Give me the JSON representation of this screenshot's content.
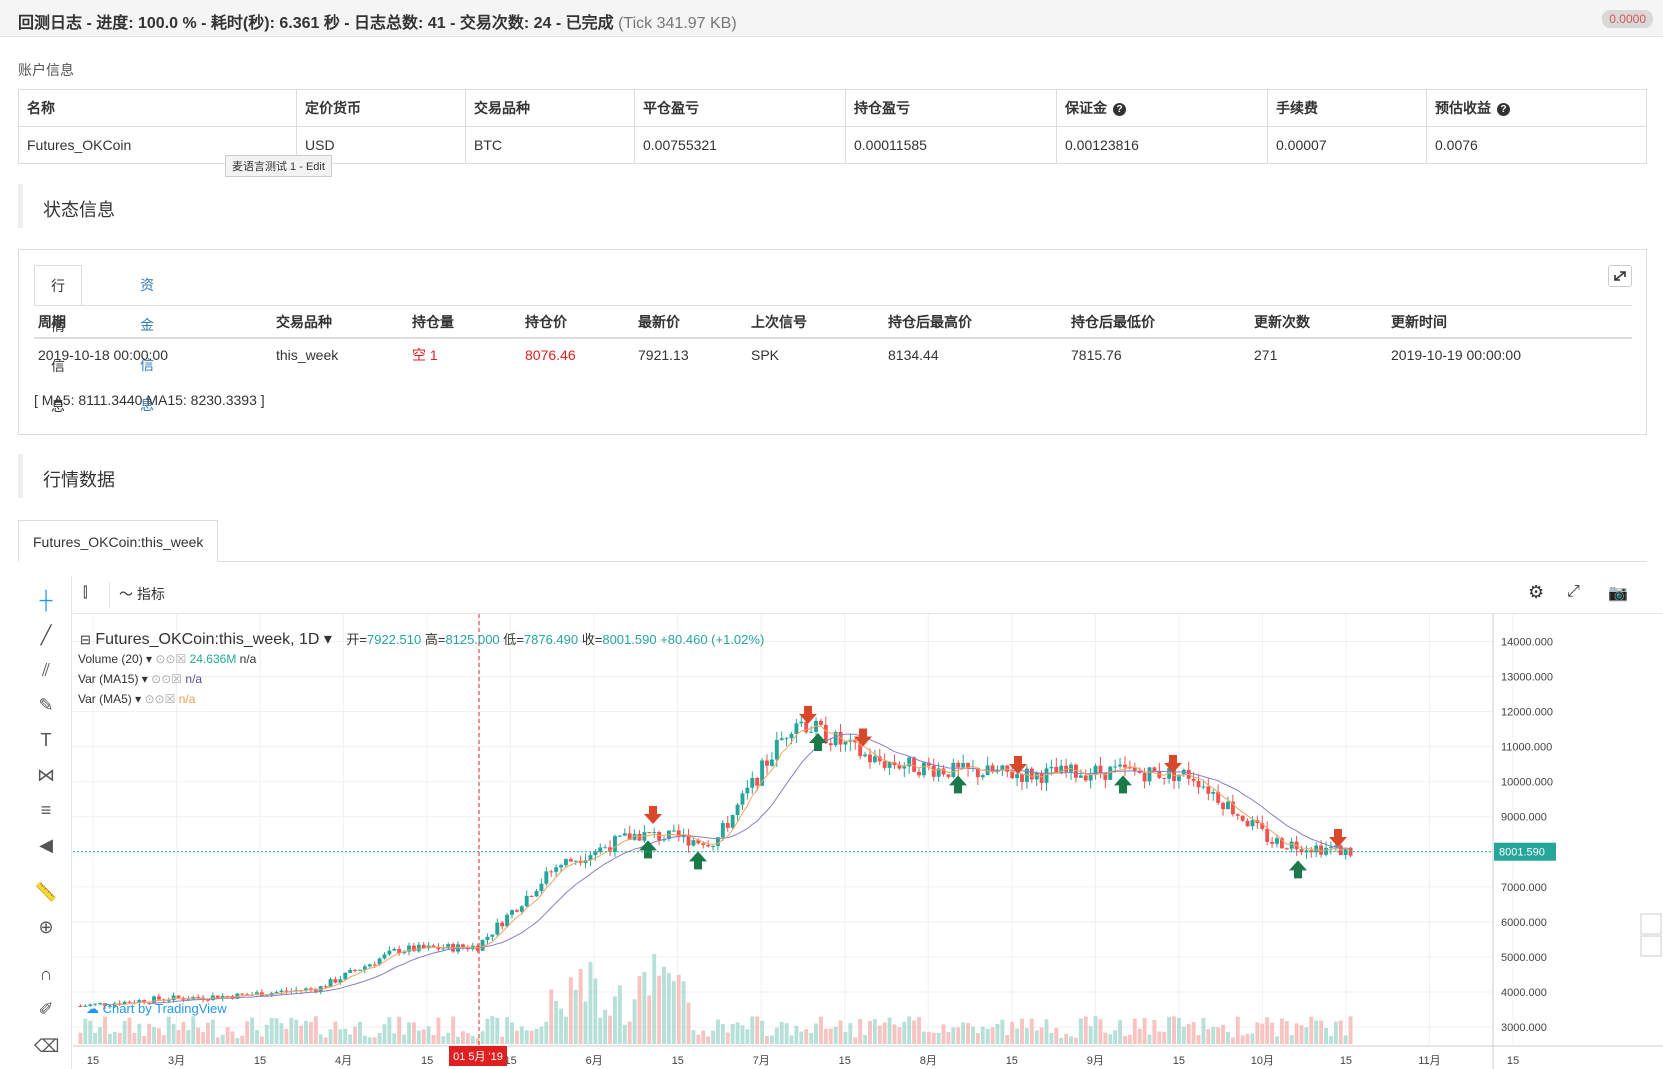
{
  "topbar": {
    "title_main": "回测日志 - 进度: 100.0 % - 耗时(秒): 6.361 秒 - 日志总数: 41 - 交易次数: 24 - 已完成",
    "title_tick": "(Tick 341.97 KB)",
    "badge": "0.0000"
  },
  "account": {
    "label": "账户信息",
    "headers": [
      "名称",
      "定价货币",
      "交易品种",
      "平仓盈亏",
      "持仓盈亏",
      "保证金",
      "手续费",
      "预估收益"
    ],
    "row": [
      "Futures_OKCoin",
      "USD",
      "BTC",
      "0.00755321",
      "0.00011585",
      "0.00123816",
      "0.00007",
      "0.0076"
    ],
    "help_icon": "?"
  },
  "tooltip": "麦语言测试 1 - Edit",
  "status": {
    "title": "状态信息",
    "tabs": [
      "行情信息",
      "资金信息"
    ],
    "headers": [
      "周期",
      "交易品种",
      "持仓量",
      "持仓价",
      "最新价",
      "上次信号",
      "持仓后最高价",
      "持仓后最低价",
      "更新次数",
      "更新时间"
    ],
    "row": [
      "2019-10-18 00:00:00",
      "this_week",
      "空 1",
      "8076.46",
      "7921.13",
      "SPK",
      "8134.44",
      "7815.76",
      "271",
      "2019-10-19 00:00:00"
    ],
    "ma_line": "[ MA5: 8111.3440 MA15: 8230.3393 ]"
  },
  "market": {
    "title": "行情数据",
    "chart_tab": "Futures_OKCoin:this_week"
  },
  "tv": {
    "indicator_label": "指标",
    "symbol": "Futures_OKCoin:this_week, 1D",
    "o_label": "开=",
    "o_val": "7922.510",
    "h_label": "高=",
    "h_val": "8125.000",
    "l_label": "低=",
    "l_val": "7876.490",
    "c_label": "收=",
    "c_val": "8001.590",
    "change": "+80.460 (+1.02%)",
    "vol_label": "Volume (20)",
    "vol_val": "24.636M",
    "vol_na": "n/a",
    "ma15_label": "Var (MA15)",
    "ma15_val": "n/a",
    "ma5_label": "Var (MA5)",
    "ma5_val": "n/a",
    "watermark": "Chart by TradingView",
    "price_tag": "8001.590",
    "crosshair_label": "01 5月 '19",
    "y_ticks": [
      "14000.000",
      "13000.000",
      "12000.000",
      "11000.000",
      "10000.000",
      "9000.000",
      "8000.000",
      "7000.000",
      "6000.000",
      "5000.000",
      "4000.000",
      "3000.000"
    ],
    "x_ticks": [
      "15",
      "3月",
      "15",
      "4月",
      "15",
      "15",
      "6月",
      "15",
      "7月",
      "15",
      "8月",
      "15",
      "9月",
      "15",
      "10月",
      "15",
      "11月",
      "15"
    ],
    "colors": {
      "up": "#26a69a",
      "down": "#ef5350",
      "ma15": "#8e7cc3",
      "ma5": "#f4a460",
      "accent": "#e02020"
    }
  },
  "chart_data": {
    "type": "candlestick",
    "title": "Futures_OKCoin:this_week, 1D",
    "xlabel": "",
    "ylabel": "",
    "ylim": [
      2800,
      14500
    ],
    "monthly_close_approx": [
      {
        "x": "2月15",
        "close": 3600
      },
      {
        "x": "3月",
        "close": 3800
      },
      {
        "x": "3月15",
        "close": 3900
      },
      {
        "x": "4月",
        "close": 4100
      },
      {
        "x": "4月15",
        "close": 5200
      },
      {
        "x": "5月1",
        "close": 5300
      },
      {
        "x": "5月15",
        "close": 7600
      },
      {
        "x": "6月",
        "close": 8500
      },
      {
        "x": "6月15",
        "close": 8300
      },
      {
        "x": "7月",
        "close": 11800
      },
      {
        "x": "7月15",
        "close": 10600
      },
      {
        "x": "8月",
        "close": 10300
      },
      {
        "x": "8月15",
        "close": 10200
      },
      {
        "x": "9月",
        "close": 10300
      },
      {
        "x": "9月15",
        "close": 10200
      },
      {
        "x": "10月",
        "close": 8300
      },
      {
        "x": "10月18",
        "close": 8001.59
      }
    ],
    "last_bar": {
      "open": 7922.51,
      "high": 8125.0,
      "low": 7876.49,
      "close": 8001.59
    }
  }
}
